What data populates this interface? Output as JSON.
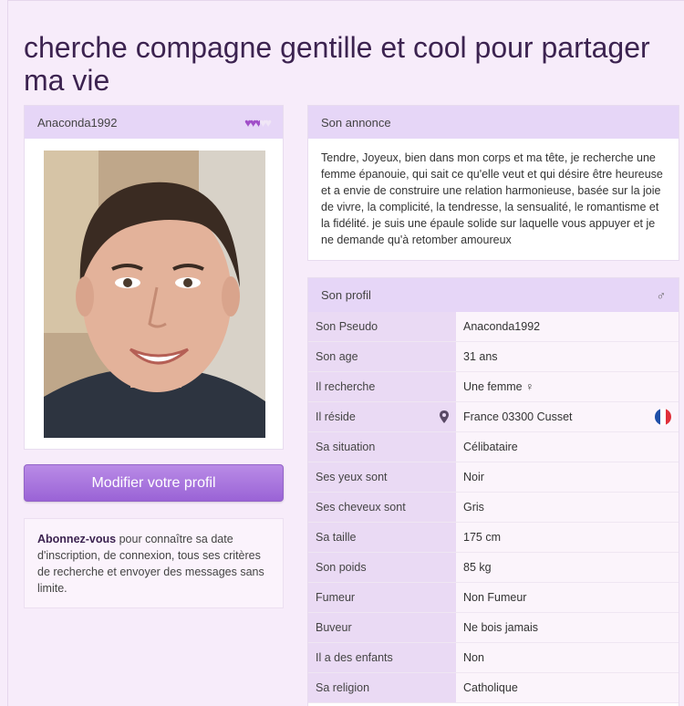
{
  "title": "cherche compagne gentille et cool pour partager ma vie",
  "user": {
    "pseudo": "Anaconda1992",
    "hearts_filled": 2.5,
    "hearts_total": 5
  },
  "modify_button": "Modifier votre profil",
  "promo": {
    "bold": "Abonnez-vous",
    "text": " pour connaître sa date d'inscription, de connexion, tous ses critères de recherche et envoyer des messages sans limite."
  },
  "announce": {
    "heading": "Son annonce",
    "text": "Tendre, Joyeux, bien dans mon corps et ma tête, je recherche une femme épanouie, qui sait ce qu'elle veut et qui désire être heureuse et a envie de construire une relation harmonieuse, basée sur la joie de vivre, la complicité, la tendresse, la sensualité, le romantisme et la fidélité. je suis une épaule solide sur laquelle vous appuyer et je ne demande qu'à retomber amoureux"
  },
  "profile": {
    "heading": "Son profil",
    "gender_icon": "male-icon",
    "rows": [
      {
        "label": "Son Pseudo",
        "value": "Anaconda1992"
      },
      {
        "label": "Son age",
        "value": "31 ans"
      },
      {
        "label": "Il recherche",
        "value": "Une femme ♀"
      },
      {
        "label": "Il réside",
        "value": "France 03300 Cusset"
      },
      {
        "label": "Sa situation",
        "value": "Célibataire"
      },
      {
        "label": "Ses yeux sont",
        "value": "Noir"
      },
      {
        "label": "Ses cheveux sont",
        "value": "Gris"
      },
      {
        "label": "Sa taille",
        "value": "175 cm"
      },
      {
        "label": "Son poids",
        "value": "85 kg"
      },
      {
        "label": "Fumeur",
        "value": "Non Fumeur"
      },
      {
        "label": "Buveur",
        "value": "Ne bois jamais"
      },
      {
        "label": "Il a des enfants",
        "value": "Non"
      },
      {
        "label": "Sa religion",
        "value": "Catholique"
      }
    ]
  },
  "colors": {
    "accent": "#9a63d6",
    "header_bg": "#e6d6f7",
    "page_bg": "#f7ecfa",
    "title": "#3c2350"
  }
}
